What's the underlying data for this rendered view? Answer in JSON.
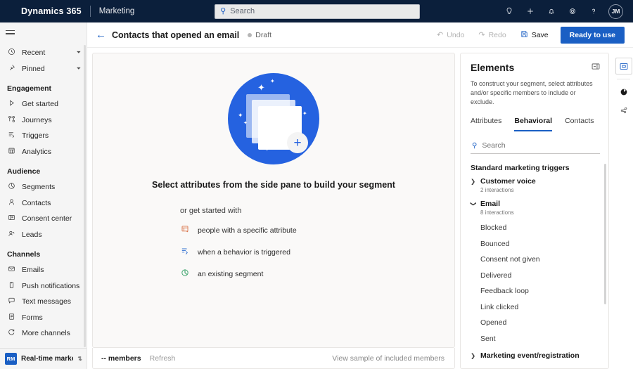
{
  "topnav": {
    "brand": "Dynamics 365",
    "app_name": "Marketing",
    "search": {
      "placeholder": "Search",
      "icon": "search-icon"
    },
    "icons": [
      {
        "name": "lightbulb-icon",
        "glyph": "☉"
      },
      {
        "name": "plus-icon",
        "glyph": "＋"
      },
      {
        "name": "bell-icon",
        "glyph": "⭔"
      },
      {
        "name": "gear-icon",
        "glyph": "⚙"
      },
      {
        "name": "help-icon",
        "glyph": "?"
      }
    ],
    "avatar_initials": "JM",
    "background": "#0b1f3b"
  },
  "sidebar": {
    "hamburger": "menu-icon",
    "top_items": [
      {
        "label": "Recent",
        "icon": "clock-icon",
        "expandable": true
      },
      {
        "label": "Pinned",
        "icon": "pin-icon",
        "expandable": true
      }
    ],
    "groups": [
      {
        "title": "Engagement",
        "items": [
          {
            "label": "Get started",
            "icon": "play-icon"
          },
          {
            "label": "Journeys",
            "icon": "journeys-icon"
          },
          {
            "label": "Triggers",
            "icon": "triggers-icon"
          },
          {
            "label": "Analytics",
            "icon": "analytics-icon"
          }
        ]
      },
      {
        "title": "Audience",
        "items": [
          {
            "label": "Segments",
            "icon": "segments-icon"
          },
          {
            "label": "Contacts",
            "icon": "contact-icon"
          },
          {
            "label": "Consent center",
            "icon": "consent-icon"
          },
          {
            "label": "Leads",
            "icon": "leads-icon"
          }
        ]
      },
      {
        "title": "Channels",
        "items": [
          {
            "label": "Emails",
            "icon": "envelope-icon"
          },
          {
            "label": "Push notifications",
            "icon": "push-icon"
          },
          {
            "label": "Text messages",
            "icon": "chat-icon"
          },
          {
            "label": "Forms",
            "icon": "forms-icon"
          },
          {
            "label": "More channels",
            "icon": "more-channels-icon"
          }
        ]
      }
    ],
    "area_switcher": {
      "badge": "RM",
      "label": "Real-time marketi...",
      "caret": "⇅"
    }
  },
  "command_bar": {
    "back_icon": "back-arrow-icon",
    "title": "Contacts that opened an email",
    "status": "Draft",
    "undo": {
      "label": "Undo",
      "icon": "undo-icon",
      "disabled": true
    },
    "redo": {
      "label": "Redo",
      "icon": "redo-icon",
      "disabled": true
    },
    "save": {
      "label": "Save",
      "icon": "save-icon",
      "disabled": false
    },
    "primary": {
      "label": "Ready to use",
      "color": "#1a5fc4"
    }
  },
  "canvas": {
    "illustration": "segment-builder-illustration",
    "headline": "Select attributes from the side pane to build your segment",
    "subline": "or get started with",
    "options": [
      {
        "label": "people with a specific attribute",
        "icon": "attribute-icon",
        "color": "#d9744a"
      },
      {
        "label": "when a behavior is triggered",
        "icon": "behavior-trigger-icon",
        "color": "#2f6fd0"
      },
      {
        "label": "an existing segment",
        "icon": "existing-segment-icon",
        "color": "#2f9e62"
      }
    ]
  },
  "status_bar": {
    "members": "-- members",
    "refresh": "Refresh",
    "sample_link": "View sample of included members"
  },
  "elements_panel": {
    "title": "Elements",
    "collapse_icon": "collapse-panel-icon",
    "description": "To construct your segment, select attributes and/or specific members to include or exclude.",
    "tabs": [
      {
        "label": "Attributes",
        "active": false
      },
      {
        "label": "Behavioral",
        "active": true
      },
      {
        "label": "Contacts",
        "active": false
      }
    ],
    "search_placeholder": "Search",
    "tree_group_title": "Standard marketing triggers",
    "nodes": [
      {
        "label": "Customer voice",
        "sub": "2 interactions",
        "expanded": false,
        "children": []
      },
      {
        "label": "Email",
        "sub": "8 interactions",
        "expanded": true,
        "children": [
          "Blocked",
          "Bounced",
          "Consent not given",
          "Delivered",
          "Feedback loop",
          "Link clicked",
          "Opened",
          "Sent"
        ]
      },
      {
        "label": "Marketing event/registration",
        "sub": "",
        "expanded": false,
        "children": []
      }
    ]
  },
  "right_rail": [
    {
      "name": "elements-panel-icon",
      "glyph": "⧉",
      "active": true
    },
    {
      "name": "insights-icon",
      "glyph": "◕",
      "active": false
    },
    {
      "name": "relationships-icon",
      "glyph": "⎇",
      "active": false
    }
  ]
}
